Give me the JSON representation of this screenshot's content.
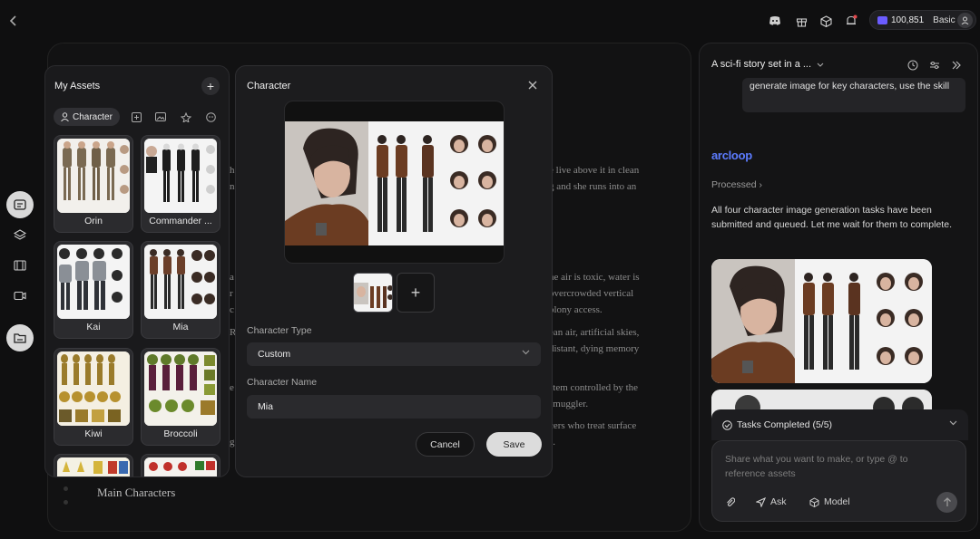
{
  "topbar": {
    "credits": "100,851",
    "plan": "Basic"
  },
  "document": {
    "lines_right": [
      "e live above it in clean",
      "g and she runs into an",
      "he air is toxic, water is",
      "overcrowded vertical",
      "olony access.",
      "ean air, artificial skies,",
      "distant, dying memory",
      "stem controlled by the",
      "smuggler.",
      "cers who treat surface",
      "s."
    ],
    "lines_left": [
      "h",
      "n",
      "a",
      "r",
      "c",
      "R",
      "e",
      "g"
    ],
    "heading": "Main Characters"
  },
  "assets": {
    "title": "My Assets",
    "filter_active": "Character",
    "cards": [
      {
        "name": "Orin"
      },
      {
        "name": "Commander ..."
      },
      {
        "name": "Kai"
      },
      {
        "name": "Mia"
      },
      {
        "name": "Kiwi"
      },
      {
        "name": "Broccoli"
      }
    ]
  },
  "modal": {
    "title": "Character",
    "type_label": "Character Type",
    "type_value": "Custom",
    "name_label": "Character Name",
    "name_value": "Mia",
    "cancel": "Cancel",
    "save": "Save"
  },
  "chat": {
    "title": "A sci-fi story set in a ...",
    "user_message": "generate image for key characters, use the skill",
    "brand": "arcloop",
    "processed": "Processed",
    "assistant_message": "All four character image generation tasks have been submitted and queued. Let me wait for them to complete.",
    "tasks_label": "Tasks Completed (5/5)",
    "composer_placeholder": "Share what you want to make, or type @ to reference assets",
    "tool_ask": "Ask",
    "tool_model": "Model"
  },
  "colors": {
    "accent_brand": "#5c7cff",
    "credit_gem": "#6b5cff",
    "notification_dot": "#e5484d"
  }
}
